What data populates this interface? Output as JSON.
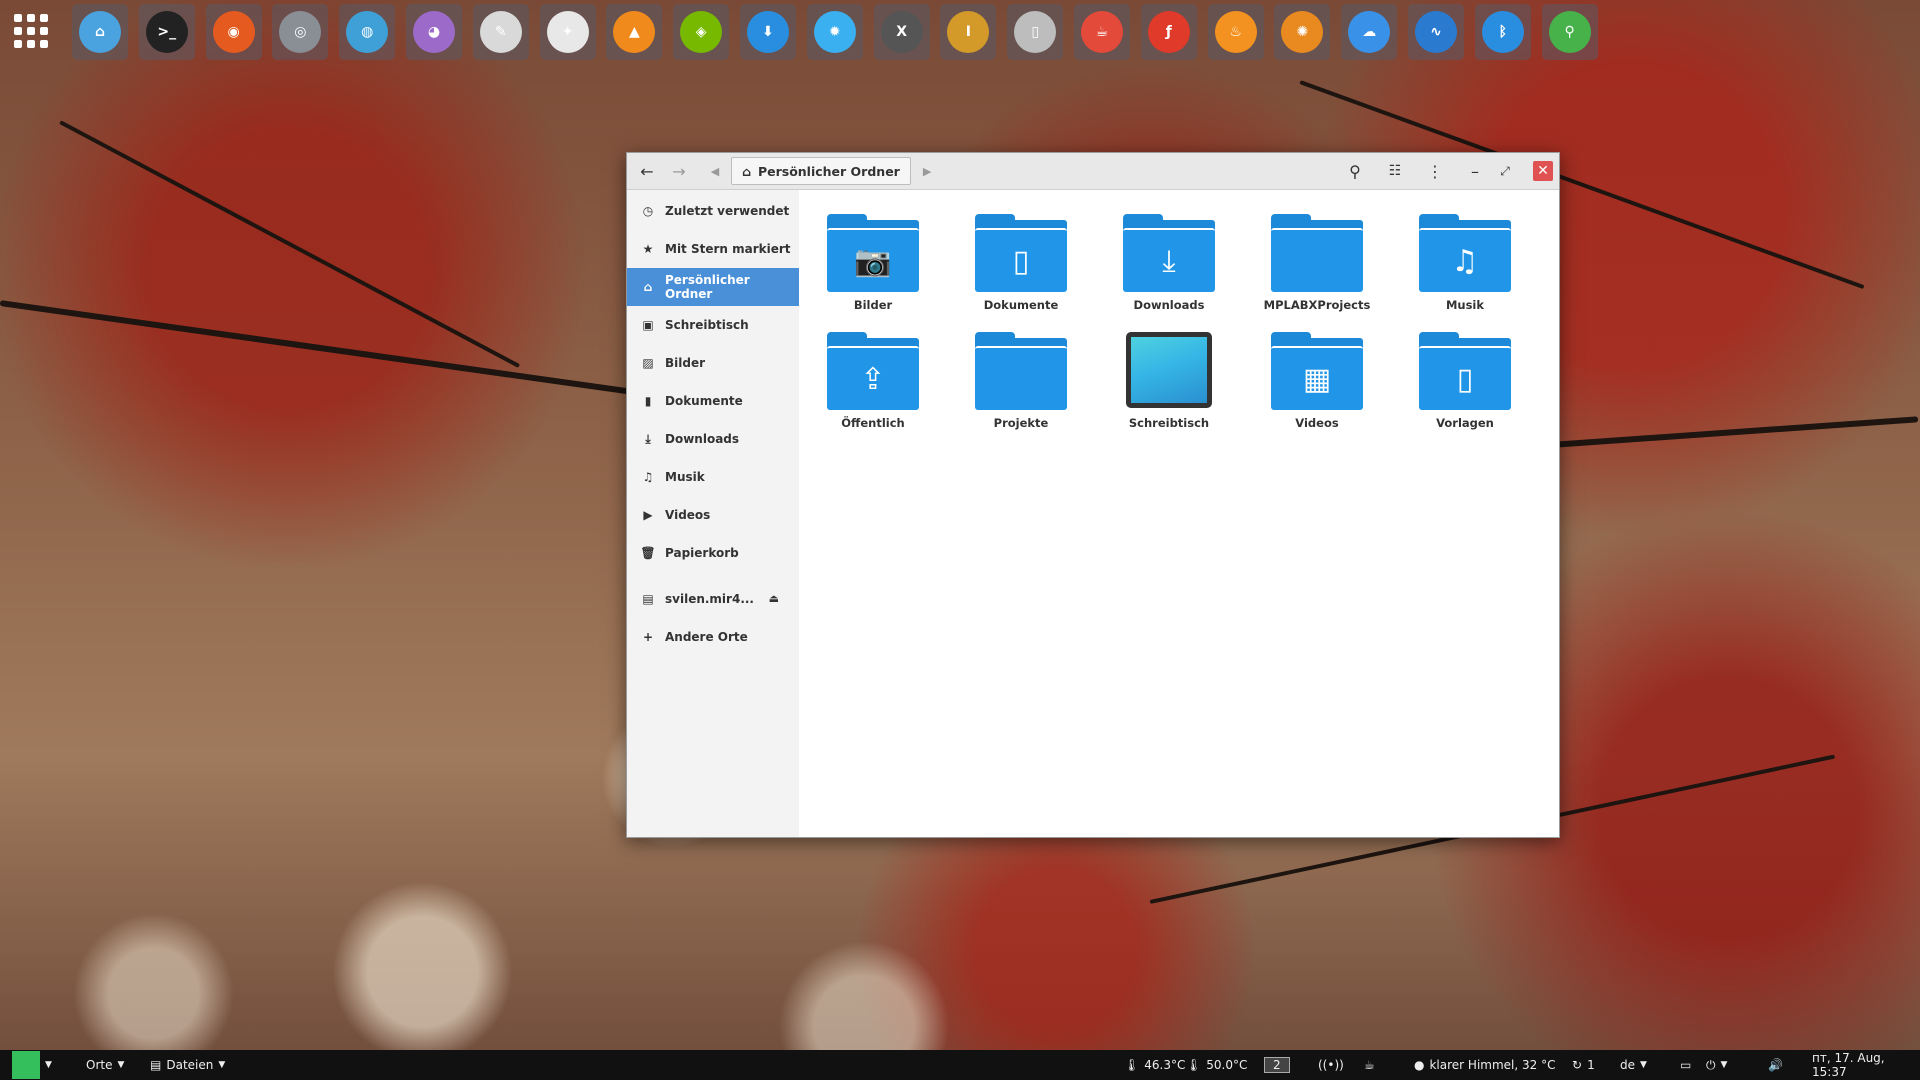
{
  "colors": {
    "accent": "#4a90d9",
    "folder": "#2196e8",
    "close": "#e05151",
    "panel": "#111111"
  },
  "dock": {
    "icons": [
      {
        "name": "home-folder-icon",
        "color": "#4aa3df",
        "glyph": "⌂"
      },
      {
        "name": "terminal-icon",
        "color": "#222",
        "glyph": ">_"
      },
      {
        "name": "firefox-icon",
        "color": "#e55a1f",
        "glyph": "◉"
      },
      {
        "name": "chrome-icon",
        "color": "#8a8f96",
        "glyph": "◎"
      },
      {
        "name": "web-browser-icon",
        "color": "#3fa0d8",
        "glyph": "◍"
      },
      {
        "name": "pidgin-icon",
        "color": "#9c6ac9",
        "glyph": "◕"
      },
      {
        "name": "text-editor-icon",
        "color": "#d9d9d9",
        "glyph": "✎"
      },
      {
        "name": "inkscape-icon",
        "color": "#e8e8e8",
        "glyph": "✦"
      },
      {
        "name": "vlc-icon",
        "color": "#f08a1c",
        "glyph": "▲"
      },
      {
        "name": "nvidia-icon",
        "color": "#76b900",
        "glyph": "◈"
      },
      {
        "name": "download-manager-icon",
        "color": "#2a8ee0",
        "glyph": "⬇"
      },
      {
        "name": "settings-gear-icon",
        "color": "#3ab0f0",
        "glyph": "✹"
      },
      {
        "name": "mplab-xide-icon",
        "color": "#555",
        "glyph": "X"
      },
      {
        "name": "mplab-ipe-icon",
        "color": "#d39a2a",
        "glyph": "I"
      },
      {
        "name": "file-icon",
        "color": "#bdbdbd",
        "glyph": "▯"
      },
      {
        "name": "java-icon",
        "color": "#e34a3a",
        "glyph": "☕"
      },
      {
        "name": "flash-icon",
        "color": "#e03a2a",
        "glyph": "ƒ"
      },
      {
        "name": "recipes-icon",
        "color": "#f39220",
        "glyph": "♨"
      },
      {
        "name": "burn-disc-icon",
        "color": "#e88a20",
        "glyph": "✺"
      },
      {
        "name": "weather-icon",
        "color": "#3a92e8",
        "glyph": "☁"
      },
      {
        "name": "oscilloscope-icon",
        "color": "#2a7ad0",
        "glyph": "∿"
      },
      {
        "name": "bluetooth-icon",
        "color": "#2a8ee0",
        "glyph": "ᛒ"
      },
      {
        "name": "search-tool-icon",
        "color": "#48b24a",
        "glyph": "⚲"
      }
    ]
  },
  "window": {
    "path_label": "Persönlicher Ordner",
    "sidebar": [
      {
        "label": "Zuletzt verwendet",
        "icon": "◷",
        "name": "recent-icon"
      },
      {
        "label": "Mit Stern markiert",
        "icon": "★",
        "name": "star-icon"
      },
      {
        "label": "Persönlicher Ordner",
        "icon": "⌂",
        "name": "home-icon",
        "active": true
      },
      {
        "label": "Schreibtisch",
        "icon": "▣",
        "name": "desktop-icon"
      },
      {
        "label": "Bilder",
        "icon": "▨",
        "name": "pictures-icon"
      },
      {
        "label": "Dokumente",
        "icon": "▮",
        "name": "document-icon"
      },
      {
        "label": "Downloads",
        "icon": "⤓",
        "name": "download-icon"
      },
      {
        "label": "Musik",
        "icon": "♫",
        "name": "music-icon"
      },
      {
        "label": "Videos",
        "icon": "▶",
        "name": "video-icon"
      },
      {
        "label": "Papierkorb",
        "icon": "🗑",
        "name": "trash-icon"
      }
    ],
    "mount": {
      "label": "svilen.mir4...",
      "icon": "▤"
    },
    "other_places": {
      "label": "Andere Orte",
      "icon": "+"
    },
    "items": [
      {
        "label": "Bilder",
        "glyph": "📷",
        "name": "pictures-folder-icon"
      },
      {
        "label": "Dokumente",
        "glyph": "▯",
        "name": "documents-folder-icon"
      },
      {
        "label": "Downloads",
        "glyph": "⤓",
        "name": "downloads-folder-icon"
      },
      {
        "label": "MPLABXProjects",
        "glyph": "",
        "name": "folder-icon"
      },
      {
        "label": "Musik",
        "glyph": "♫",
        "name": "music-folder-icon"
      },
      {
        "label": "Öffentlich",
        "glyph": "⇪",
        "name": "public-folder-icon"
      },
      {
        "label": "Projekte",
        "glyph": "",
        "name": "folder-icon"
      },
      {
        "label": "Schreibtisch",
        "glyph": "",
        "name": "desktop-folder-icon",
        "desktop": true
      },
      {
        "label": "Videos",
        "glyph": "▦",
        "name": "videos-folder-icon"
      },
      {
        "label": "Vorlagen",
        "glyph": "▯",
        "name": "templates-folder-icon"
      }
    ]
  },
  "panel": {
    "places": "Orte",
    "files": "Dateien",
    "temp1": "46.3°C",
    "temp2": "50.0°C",
    "workspace": "2",
    "weather": "klarer Himmel, 32 °C",
    "updates": "1",
    "lang": "de",
    "clock": "пт, 17. Aug, 15:37"
  }
}
